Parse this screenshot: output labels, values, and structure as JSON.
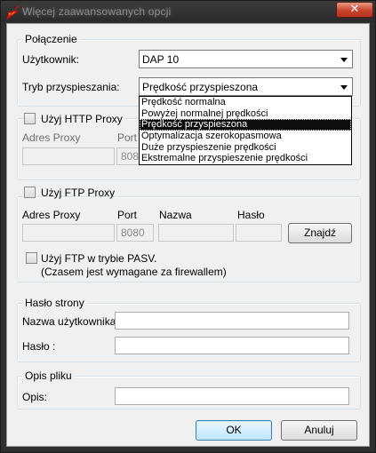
{
  "window": {
    "title": "Więcej zaawansowanych opcji",
    "close_label": "✕"
  },
  "connection": {
    "legend": "Połączenie",
    "user_label": "Użytkownik:",
    "user_value": "DAP 10",
    "mode_label": "Tryb przyspieszania:",
    "mode_value": "Prędkość przyspieszona",
    "mode_options": [
      "Prędkość normalna",
      "Powyżej normalnej prędkości",
      "Prędkość przyspieszona",
      "Optymalizacja szerokopasmowa",
      "Duże przyspieszenie prędkości",
      "Ekstremalne przyspieszenie prędkości"
    ],
    "selected_option_index": 2
  },
  "http_proxy": {
    "checkbox_label": "Użyj HTTP Proxy",
    "address_label": "Adres Proxy",
    "port_label": "Port",
    "port_value": "8080",
    "checked": false
  },
  "ftp_proxy": {
    "checkbox_label": "Użyj FTP Proxy",
    "address_label": "Adres Proxy",
    "port_label": "Port",
    "name_label": "Nazwa",
    "password_label": "Hasło",
    "port_value": "8080",
    "find_button": "Znajdź",
    "pasv_label": "Użyj FTP w trybie PASV.",
    "pasv_note": "(Czasem jest wymagane za firewallem)",
    "checked": false,
    "pasv_checked": false
  },
  "site_password": {
    "legend": "Hasło strony",
    "username_label": "Nazwa użytkownika:",
    "password_label": "Hasło :",
    "username_value": "",
    "password_value": ""
  },
  "file_description": {
    "legend": "Opis pliku",
    "description_label": "Opis:",
    "description_value": ""
  },
  "footer": {
    "ok_label": "OK",
    "cancel_label": "Anuluj"
  }
}
